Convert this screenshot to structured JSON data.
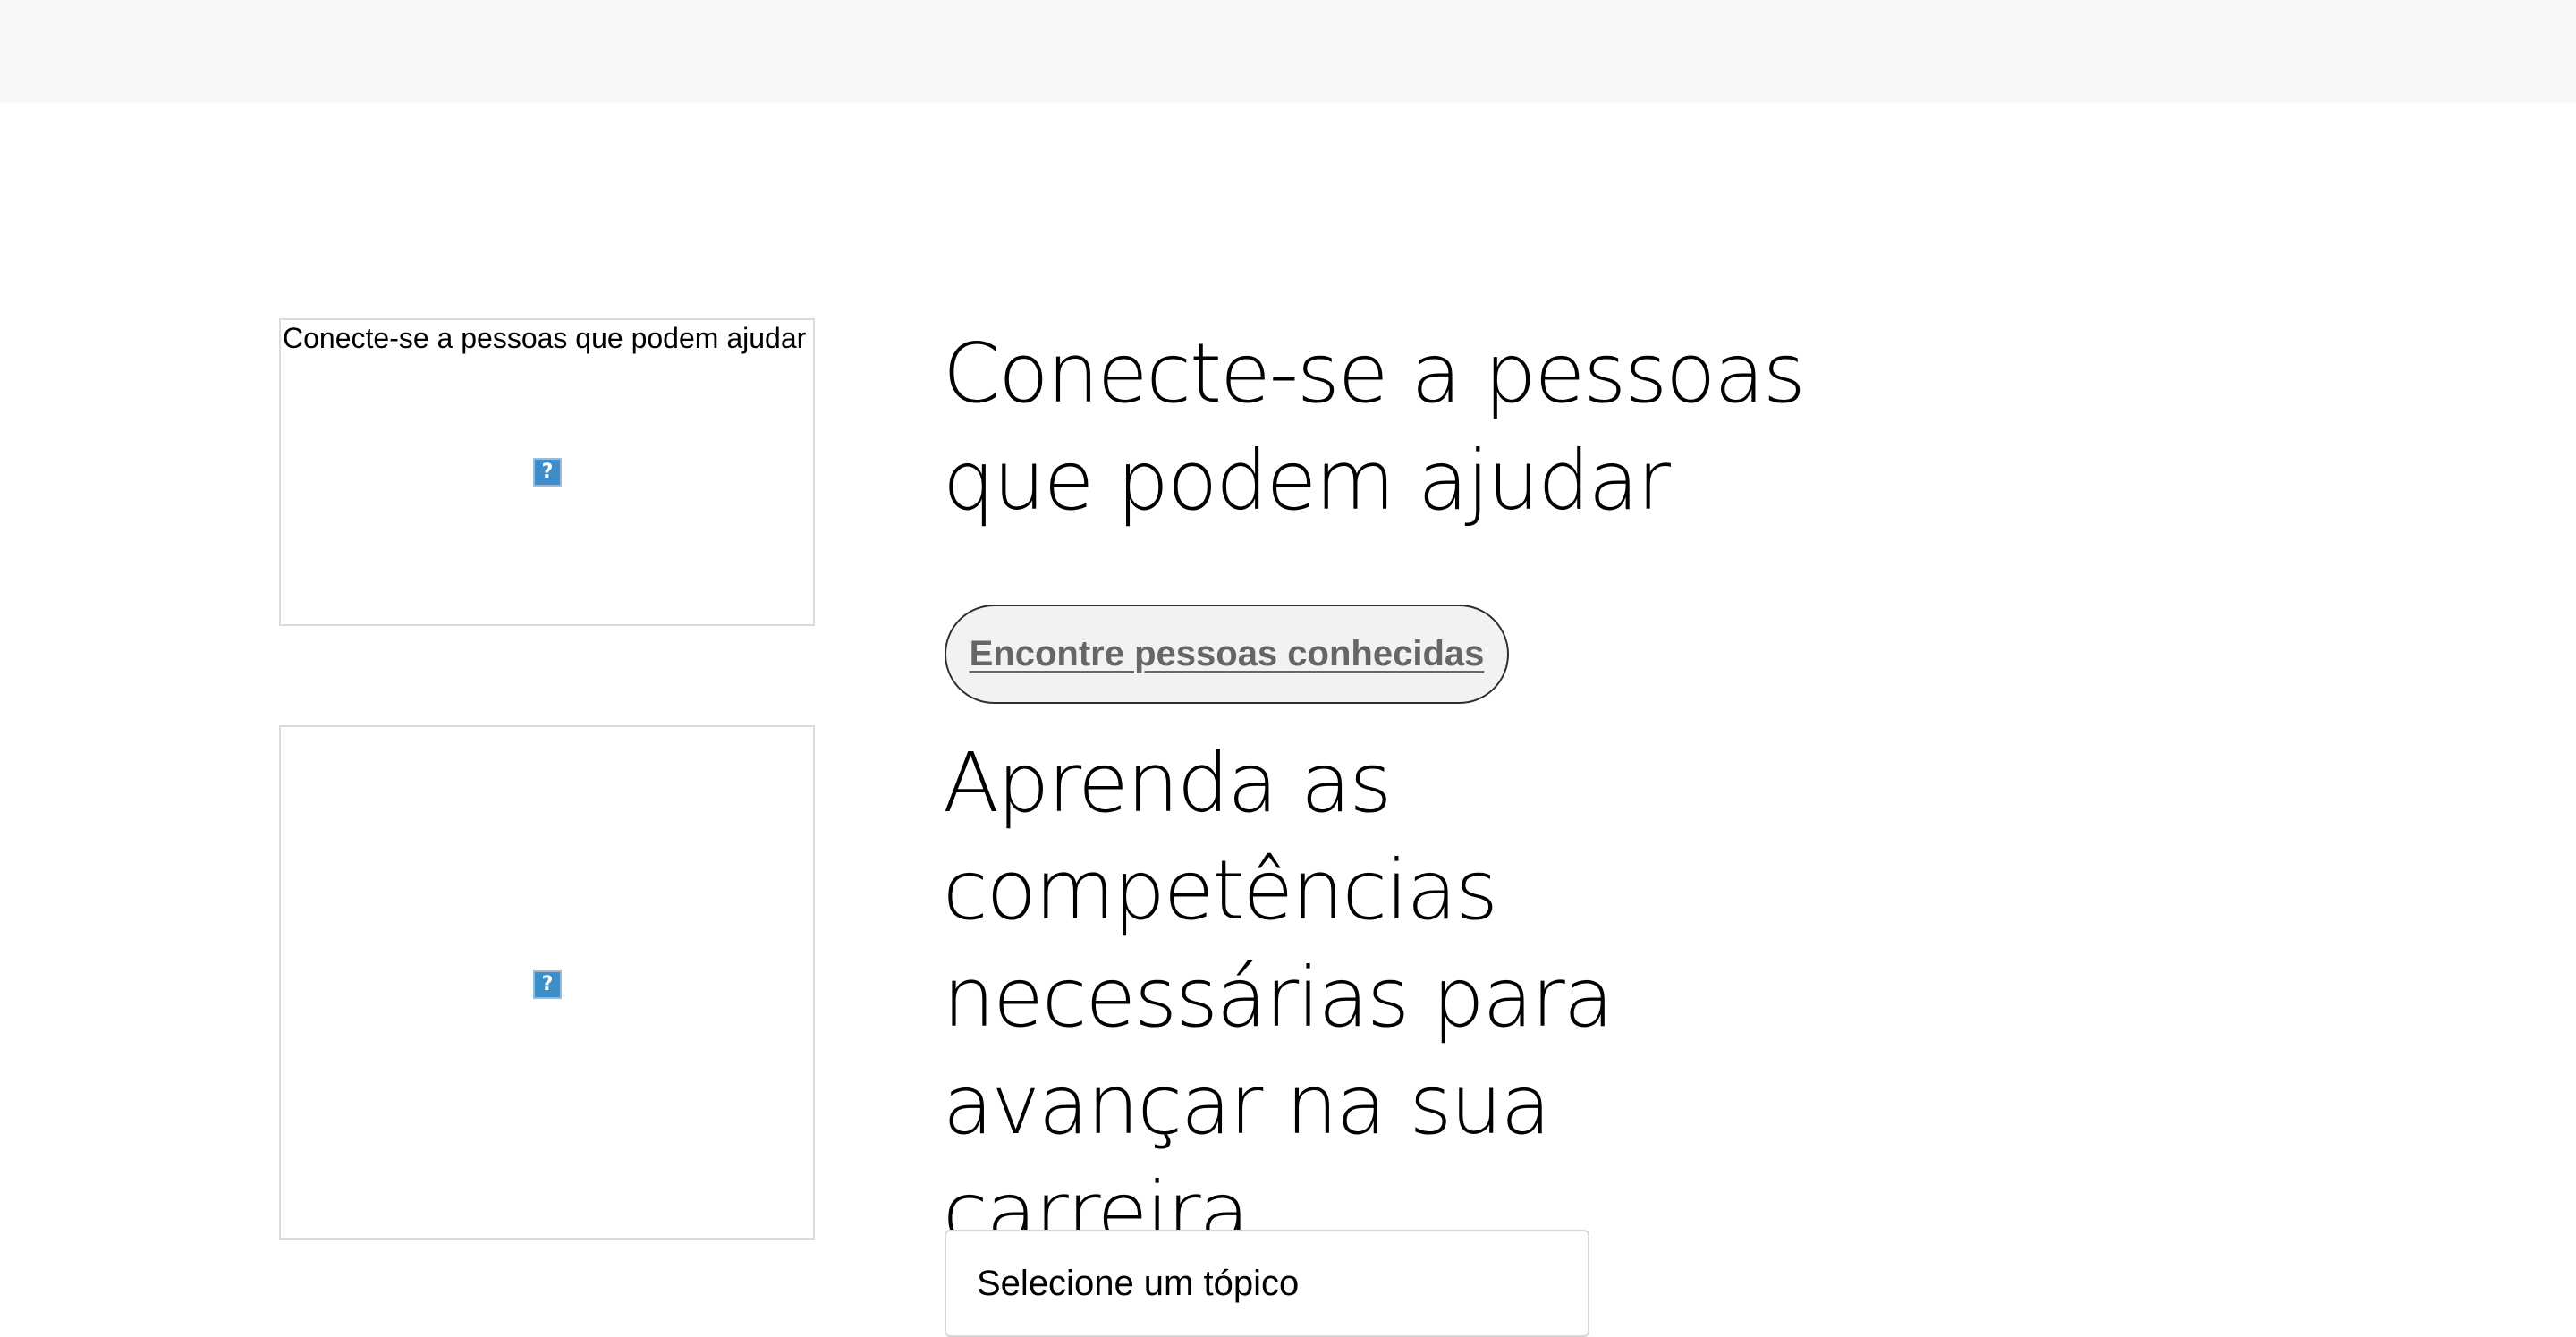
{
  "section_one": {
    "image_alt": "Conecte-se a pessoas que podem ajudar",
    "broken_icon_glyph": "?",
    "heading": "Conecte-se a pessoas\nque podem ajudar",
    "button_label": "Encontre pessoas conhecidas"
  },
  "section_two": {
    "broken_icon_glyph": "?",
    "heading": "Aprenda as\ncompetências\nnecessárias para\navançar na sua carreira",
    "select_label": "Selecione um tópico"
  },
  "colors": {
    "top_bar_bg": "#f9f8f7",
    "button_bg": "#f3f2f1",
    "button_text": "#666666",
    "broken_icon_bg": "#3b8ec9"
  },
  "icons": {
    "broken_image": "broken-image-icon"
  }
}
